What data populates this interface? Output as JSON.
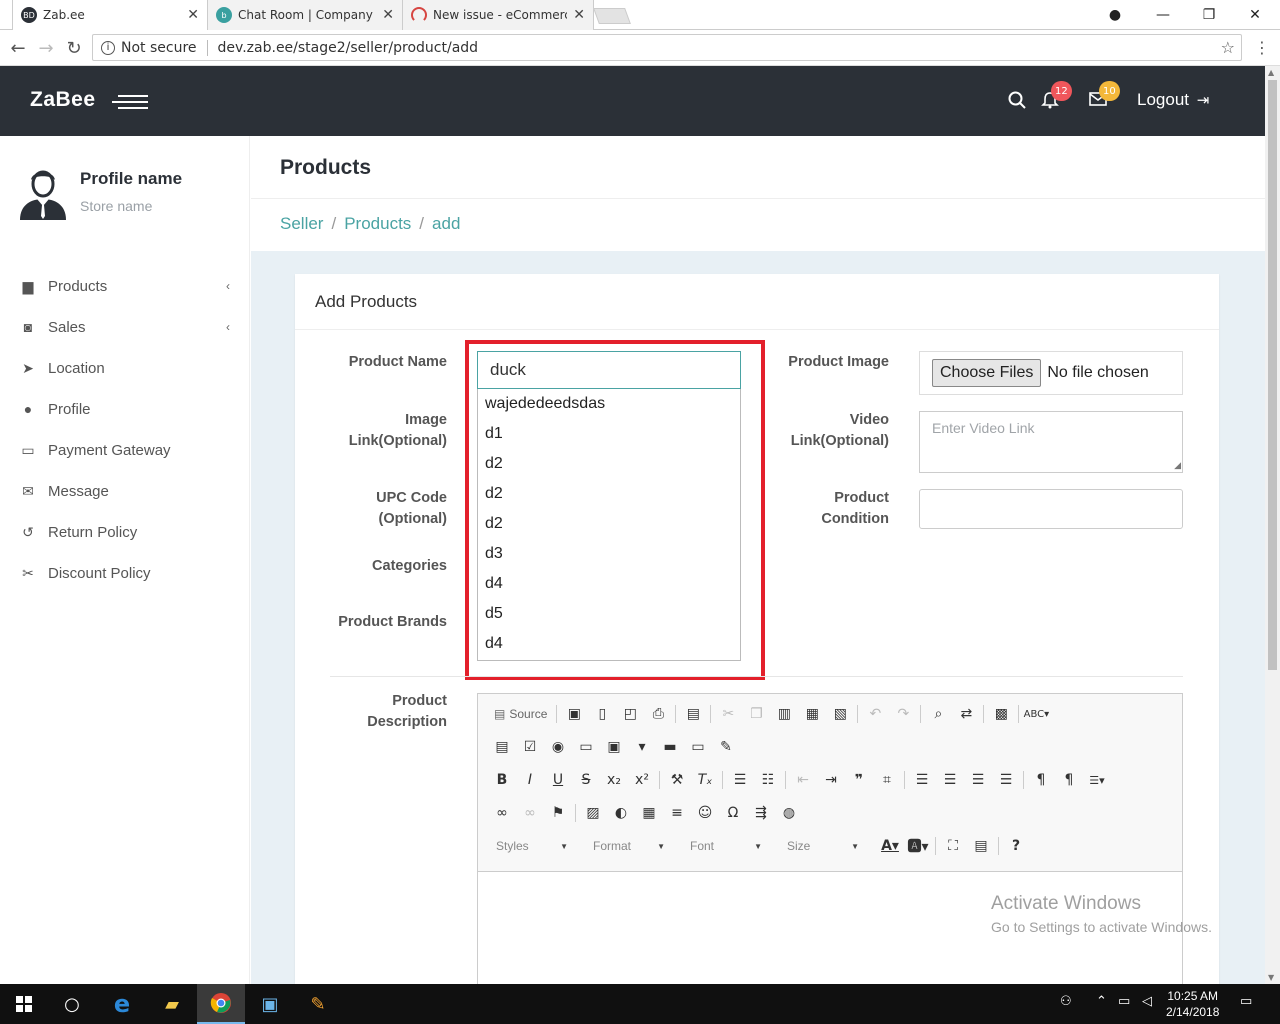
{
  "browser": {
    "tabs": [
      {
        "title": "Zab.ee",
        "favicon": "BD",
        "favicon_color": "#2b3037",
        "active": true
      },
      {
        "title": "Chat Room | Company | T",
        "favicon": "b",
        "favicon_color": "#3aa0a0",
        "active": false
      },
      {
        "title": "New issue - eCommerce",
        "favicon": "arc",
        "favicon_color": "#d64541",
        "active": false
      }
    ],
    "security_label": "Not secure",
    "url": "dev.zab.ee/stage2/seller/product/add"
  },
  "topnav": {
    "brand": "ZaBee",
    "notifications_count": "12",
    "messages_count": "10",
    "logout_label": "Logout",
    "bg_color": "#2b3037"
  },
  "sidebar": {
    "profile_name": "Profile name",
    "store_name": "Store name",
    "items": [
      {
        "label": "Products",
        "icon": "briefcase-icon",
        "has_chevron": true
      },
      {
        "label": "Sales",
        "icon": "money-icon",
        "has_chevron": true
      },
      {
        "label": "Location",
        "icon": "location-arrow-icon",
        "has_chevron": false
      },
      {
        "label": "Profile",
        "icon": "user-icon",
        "has_chevron": false
      },
      {
        "label": "Payment Gateway",
        "icon": "credit-card-icon",
        "has_chevron": false
      },
      {
        "label": "Message",
        "icon": "envelope-icon",
        "has_chevron": false
      },
      {
        "label": "Return Policy",
        "icon": "undo-icon",
        "has_chevron": false
      },
      {
        "label": "Discount Policy",
        "icon": "scissors-icon",
        "has_chevron": false
      }
    ]
  },
  "main": {
    "page_title": "Products",
    "breadcrumbs": [
      "Seller",
      "Products",
      "add"
    ],
    "card_title": "Add Products",
    "labels": {
      "product_name": "Product Name",
      "image_link_1": "Image",
      "image_link_2": "Link(Optional)",
      "upc_1": "UPC Code",
      "upc_2": "(Optional)",
      "categories": "Categories",
      "brands": "Product Brands",
      "product_image": "Product Image",
      "video_1": "Video",
      "video_2": "Link(Optional)",
      "condition_1": "Product",
      "condition_2": "Condition",
      "description_1": "Product",
      "description_2": "Description"
    },
    "product_name_value": "duck",
    "autocomplete_options": [
      "wajededeedsdas",
      "d1",
      "d2",
      "d2",
      "d2",
      "d3",
      "d4",
      "d5",
      "d4"
    ],
    "file_button_label": "Choose Files",
    "file_status": "No file chosen",
    "video_placeholder": "Enter Video Link",
    "highlight_color": "#e3202b"
  },
  "editor": {
    "source_label": "Source",
    "combos": [
      "Styles",
      "Format",
      "Font",
      "Size"
    ]
  },
  "watermark": {
    "line1": "Activate Windows",
    "line2": "Go to Settings to activate Windows."
  },
  "taskbar": {
    "time": "10:25 AM",
    "date": "2/14/2018"
  }
}
